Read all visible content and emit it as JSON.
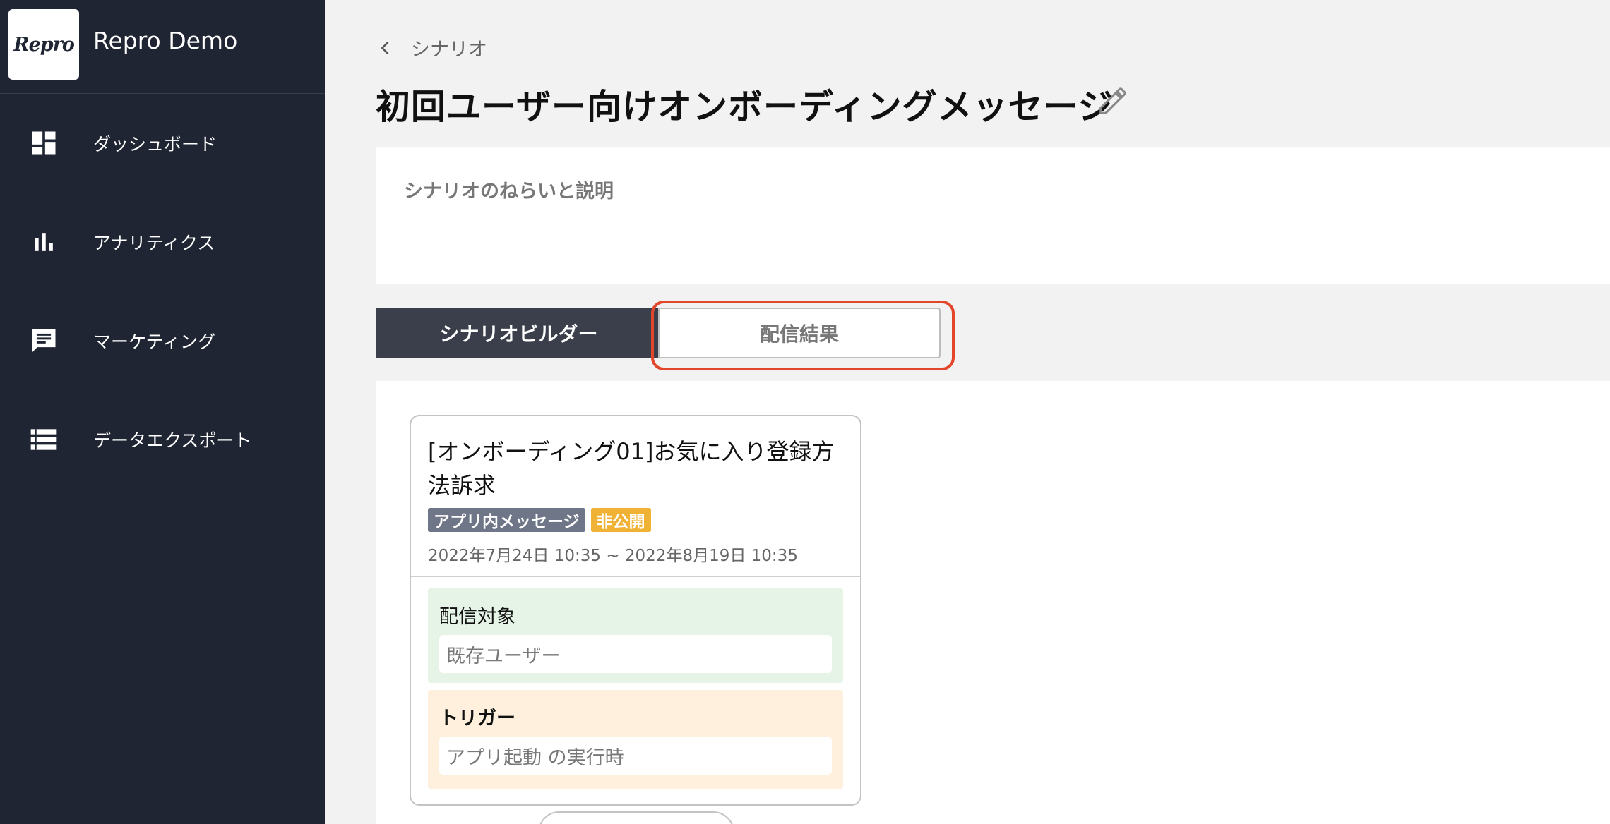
{
  "app": {
    "logo_text": "Repro",
    "name": "Repro Demo"
  },
  "sidebar": {
    "items": [
      {
        "label": "ダッシュボード",
        "icon": "dashboard-icon"
      },
      {
        "label": "アナリティクス",
        "icon": "bar-chart-icon"
      },
      {
        "label": "マーケティング",
        "icon": "chat-bubble-icon"
      },
      {
        "label": "データエクスポート",
        "icon": "list-icon"
      }
    ]
  },
  "breadcrumb": {
    "back_label": "シナリオ"
  },
  "page": {
    "title": "初回ユーザー向けオンボーディングメッセージ"
  },
  "description": {
    "label": "シナリオのねらいと説明"
  },
  "tabs": {
    "builder": "シナリオビルダー",
    "results": "配信結果"
  },
  "card": {
    "title": "[オンボーディング01]お気に入り登録方法訴求",
    "badge_type": "アプリ内メッセージ",
    "badge_status": "非公開",
    "period": "2022年7月24日 10:35 ~ 2022年8月19日 10:35",
    "target_title": "配信対象",
    "target_value": "既存ユーザー",
    "trigger_title": "トリガー",
    "trigger_value": "アプリ起動 の実行時"
  },
  "colors": {
    "sidebar_bg": "#1f2532",
    "highlight": "#e2462b",
    "badge_type": "#6e7687",
    "badge_status": "#f0b234",
    "target_bg": "#e5f4e7",
    "trigger_bg": "#fef0dd"
  }
}
